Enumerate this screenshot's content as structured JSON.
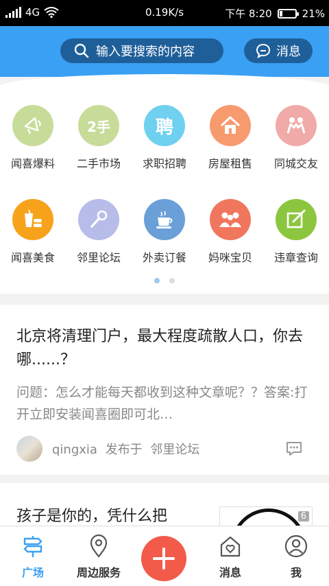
{
  "status_bar": {
    "network": "4G",
    "speed": "0.19K/s",
    "time": "下午 8:20",
    "battery_percent": "21%",
    "battery_level": 0.21
  },
  "header": {
    "search_placeholder": "输入要搜索的内容",
    "message_label": "消息",
    "accent_color": "#3aa0f3",
    "pill_color": "#1f5f99"
  },
  "grid": {
    "items": [
      {
        "label": "闻喜爆料",
        "icon": "megaphone-icon",
        "color": "#c8dc9a"
      },
      {
        "label": "二手市场",
        "icon": "second-hand-icon",
        "glyph": "2手",
        "color": "#c8dc9a"
      },
      {
        "label": "求职招聘",
        "icon": "recruit-icon",
        "glyph": "聘",
        "color": "#6fd0f0"
      },
      {
        "label": "房屋租售",
        "icon": "house-icon",
        "color": "#f79a6e"
      },
      {
        "label": "同城交友",
        "icon": "friends-icon",
        "color": "#f0aaa8"
      },
      {
        "label": "闻喜美食",
        "icon": "food-icon",
        "color": "#f7a21b"
      },
      {
        "label": "邻里论坛",
        "icon": "microphone-icon",
        "color": "#b7bde8"
      },
      {
        "label": "外卖订餐",
        "icon": "takeout-cup-icon",
        "color": "#6a9fd8"
      },
      {
        "label": "妈咪宝贝",
        "icon": "family-icon",
        "color": "#f0765e"
      },
      {
        "label": "违章查询",
        "icon": "edit-note-icon",
        "color": "#8cc63e"
      }
    ],
    "page_count": 2,
    "current_page": 1
  },
  "feed": {
    "posts": [
      {
        "title": "北京将清理门户，最大程度疏散人口，你去哪......？",
        "excerpt": "问题：怎么才能每天都收到这种文章呢？？答案:打开立即安装闻喜圈即可北…",
        "author": "qingxia",
        "published_in": "发布于",
        "forum": "邻里论坛"
      },
      {
        "title": "孩子是你的，凭什么把",
        "thumb_badge": "6"
      }
    ]
  },
  "bottom_nav": {
    "items": [
      {
        "label": "广场",
        "icon": "signpost-icon",
        "active": true
      },
      {
        "label": "周边服务",
        "icon": "location-pin-icon",
        "active": false
      },
      {
        "label": "",
        "icon": "plus-icon",
        "active": false
      },
      {
        "label": "消息",
        "icon": "home-heart-icon",
        "active": false
      },
      {
        "label": "我",
        "icon": "user-icon",
        "active": false
      }
    ],
    "fab_color": "#f25b4a"
  }
}
